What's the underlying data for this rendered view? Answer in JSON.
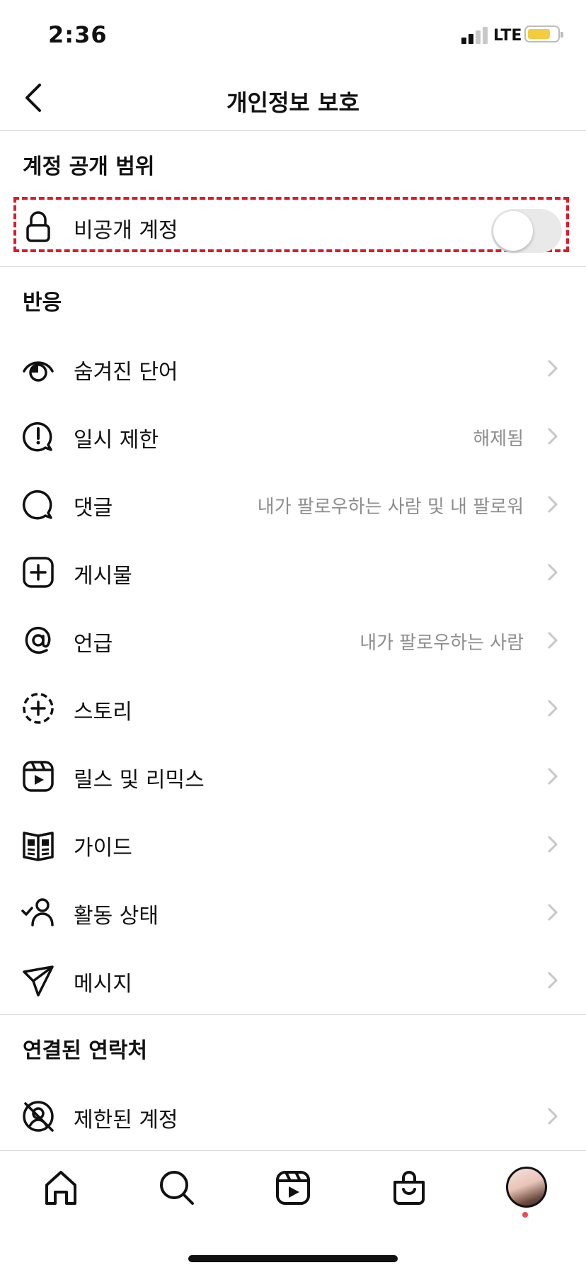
{
  "status_bar": {
    "time": "2:36",
    "network": "LTE",
    "battery_color": "#f3cc3f"
  },
  "header": {
    "title": "개인정보 보호",
    "back_icon": "chevron-left-icon"
  },
  "sections": {
    "account_privacy": {
      "title": "계정 공개 범위",
      "private_account": {
        "label": "비공개 계정",
        "icon": "lock-icon",
        "toggle_on": false
      }
    },
    "interactions": {
      "title": "반응",
      "items": [
        {
          "label": "숨겨진 단어",
          "value": "",
          "icon": "hidden-words-icon"
        },
        {
          "label": "일시 제한",
          "value": "해제됨",
          "icon": "limits-icon"
        },
        {
          "label": "댓글",
          "value": "내가 팔로우하는 사람 및 내 팔로워",
          "icon": "comment-icon"
        },
        {
          "label": "게시물",
          "value": "",
          "icon": "post-icon"
        },
        {
          "label": "언급",
          "value": "내가 팔로우하는 사람",
          "icon": "mention-icon"
        },
        {
          "label": "스토리",
          "value": "",
          "icon": "story-icon"
        },
        {
          "label": "릴스 및 리믹스",
          "value": "",
          "icon": "reels-icon"
        },
        {
          "label": "가이드",
          "value": "",
          "icon": "guide-icon"
        },
        {
          "label": "활동 상태",
          "value": "",
          "icon": "activity-status-icon"
        },
        {
          "label": "메시지",
          "value": "",
          "icon": "message-icon"
        }
      ]
    },
    "connections": {
      "title": "연결된 연락처",
      "items": [
        {
          "label": "제한된 계정",
          "value": "",
          "icon": "restricted-icon"
        }
      ]
    }
  },
  "tab_bar": {
    "tabs": [
      "home-icon",
      "search-icon",
      "reels-icon",
      "shop-icon",
      "profile-avatar"
    ],
    "notification_dot_color": "#ed4956"
  },
  "highlight_color": "#e0192b"
}
